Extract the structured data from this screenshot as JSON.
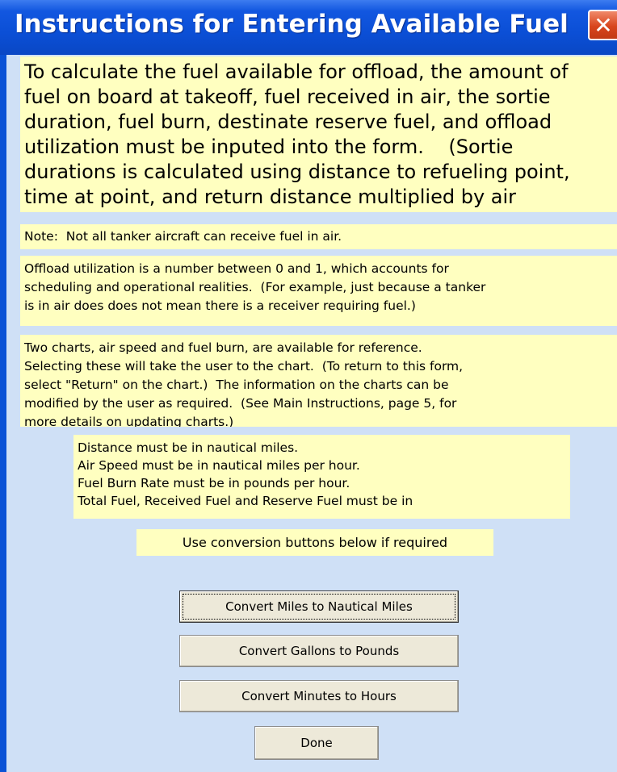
{
  "window": {
    "title": "Instructions for Entering Available Fuel",
    "close_glyph": "✕"
  },
  "main_text": {
    "lines": [
      "To calculate the fuel available for offload, the amount of",
      "fuel on board at takeoff, fuel received in air, the sortie",
      "duration, fuel burn, destinate reserve fuel, and offload",
      "utilization must be inputed into the form.    (Sortie",
      "durations is calculated using distance to refueling point,",
      "time at point, and return distance multiplied by air"
    ]
  },
  "note": "Note:  Not all tanker aircraft can receive fuel in air.",
  "offload": {
    "lines": [
      "Offload utilization is a number between 0 and 1, which accounts for",
      "scheduling and operational realities.  (For example, just because a tanker",
      "is in air does does not mean there is a receiver requiring fuel.)"
    ]
  },
  "charts": {
    "lines": [
      "Two charts, air speed and fuel burn, are available for reference.",
      "Selecting these will take the user to the chart.  (To return to this form,",
      "select \"Return\" on the chart.)  The information on the charts can be",
      "modified by the user as required.  (See Main Instructions, page 5, for",
      "more details on updating charts.)"
    ]
  },
  "units": {
    "lines": [
      "Distance must be in nautical miles.",
      "Air Speed must be in nautical miles per hour.",
      "Fuel Burn Rate must be in pounds per hour.",
      "Total Fuel, Received Fuel and Reserve Fuel must be in"
    ]
  },
  "conversion_hint": "Use conversion buttons below if required",
  "buttons": {
    "miles": "Convert Miles to Nautical Miles",
    "gallons": "Convert Gallons to Pounds",
    "minutes": "Convert Minutes to Hours",
    "done": "Done"
  },
  "colors": {
    "title_bar": "#0b4fd6",
    "client_bg": "#cfe0f6",
    "text_box_bg": "#ffffc0",
    "close_button": "#d8451d",
    "button_face": "#ede9d9"
  }
}
